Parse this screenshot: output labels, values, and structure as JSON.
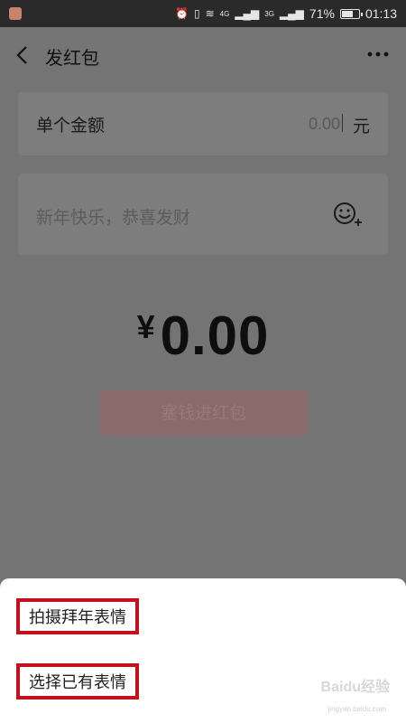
{
  "status_bar": {
    "signal_4g": "4G",
    "signal_3g": "3G",
    "battery": "71%",
    "battery_level": 0.71,
    "time": "01:13"
  },
  "header": {
    "title": "发红包"
  },
  "amount": {
    "label": "单个金额",
    "value": "0.00",
    "unit": "元"
  },
  "greeting": {
    "placeholder": "新年快乐，恭喜发财"
  },
  "total": {
    "currency": "¥",
    "value": "0.00"
  },
  "submit": {
    "label": "塞钱进红包"
  },
  "sheet": {
    "options": [
      {
        "label": "拍摄拜年表情"
      },
      {
        "label": "选择已有表情"
      }
    ]
  },
  "watermark": {
    "brand": "Baidu经验",
    "url": "jingyan.baidu.com"
  },
  "icons": {
    "back": "chevron-left-icon",
    "more": "more-dots-icon",
    "emoji": "emoji-add-icon"
  },
  "colors": {
    "highlight_border": "#c4101a",
    "submit_button": "#8a6a6a"
  }
}
